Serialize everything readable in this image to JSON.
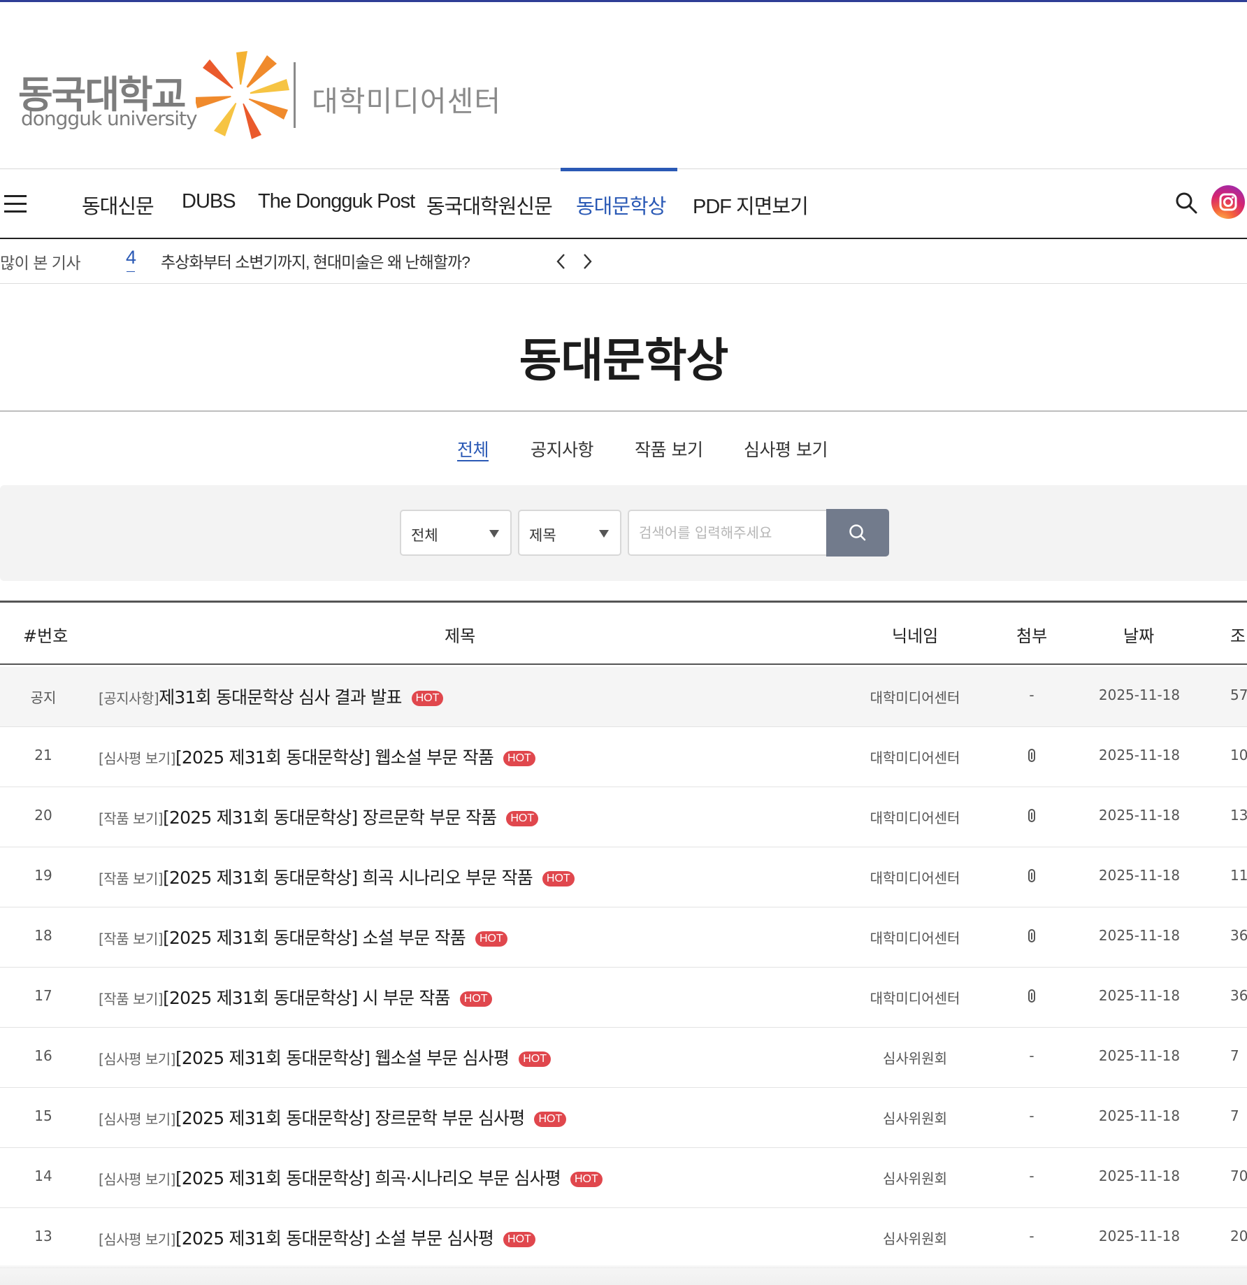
{
  "logo": {
    "korean": "동국대학교",
    "english": "dongguk university",
    "center_name": "대학미디어센터"
  },
  "nav": {
    "items": [
      {
        "label": "동대신문"
      },
      {
        "label": "DUBS"
      },
      {
        "label": "The Dongguk Post"
      },
      {
        "label": "동국대학원신문"
      },
      {
        "label": "동대문학상",
        "active": true
      },
      {
        "label": "PDF 지면보기"
      }
    ],
    "menu_icon": "hamburger-menu-icon",
    "search_icon": "search-icon",
    "instagram_icon": "instagram-icon",
    "accent_color": "#2a59b5"
  },
  "ticker": {
    "label": "많이 본 기사",
    "rank": "4",
    "headline": "추상화부터 소변기까지, 현대미술은 왜 난해할까?"
  },
  "page": {
    "title": "동대문학상"
  },
  "categories": [
    {
      "label": "전체",
      "active": true
    },
    {
      "label": "공지사항"
    },
    {
      "label": "작품 보기"
    },
    {
      "label": "심사평 보기"
    }
  ],
  "search": {
    "category_value": "전체",
    "field_value": "제목",
    "placeholder": "검색어를 입력해주세요",
    "button_color": "#727b8c"
  },
  "table": {
    "headers": {
      "number": "#번호",
      "title": "제목",
      "nickname": "닉네임",
      "attachment": "첨부",
      "date": "날짜",
      "views": "조"
    },
    "hot_label": "HOT",
    "hot_color": "#e0474d",
    "rows": [
      {
        "num": "공지",
        "category": "[공지사항]",
        "title": "제31회 동대문학상 심사 결과 발표",
        "nickname": "대학미디어센터",
        "attach": "-",
        "date": "2025-11-18",
        "views": "57",
        "notice": true
      },
      {
        "num": "21",
        "category": "[심사평 보기]",
        "title": "[2025 제31회 동대문학상] 웹소설 부문 작품",
        "nickname": "대학미디어센터",
        "attach": "clip",
        "date": "2025-11-18",
        "views": "10"
      },
      {
        "num": "20",
        "category": "[작품 보기]",
        "title": "[2025 제31회 동대문학상] 장르문학 부문 작품",
        "nickname": "대학미디어센터",
        "attach": "clip",
        "date": "2025-11-18",
        "views": "13"
      },
      {
        "num": "19",
        "category": "[작품 보기]",
        "title": "[2025 제31회 동대문학상] 희곡 시나리오 부문 작품",
        "nickname": "대학미디어센터",
        "attach": "clip",
        "date": "2025-11-18",
        "views": "11"
      },
      {
        "num": "18",
        "category": "[작품 보기]",
        "title": "[2025 제31회 동대문학상] 소설 부문 작품",
        "nickname": "대학미디어센터",
        "attach": "clip",
        "date": "2025-11-18",
        "views": "36"
      },
      {
        "num": "17",
        "category": "[작품 보기]",
        "title": "[2025 제31회 동대문학상] 시 부문 작품",
        "nickname": "대학미디어센터",
        "attach": "clip",
        "date": "2025-11-18",
        "views": "36"
      },
      {
        "num": "16",
        "category": "[심사평 보기]",
        "title": "[2025 제31회 동대문학상] 웹소설 부문 심사평",
        "nickname": "심사위원회",
        "attach": "-",
        "date": "2025-11-18",
        "views": "7"
      },
      {
        "num": "15",
        "category": "[심사평 보기]",
        "title": "[2025 제31회 동대문학상] 장르문학 부문 심사평",
        "nickname": "심사위원회",
        "attach": "-",
        "date": "2025-11-18",
        "views": "7"
      },
      {
        "num": "14",
        "category": "[심사평 보기]",
        "title": "[2025 제31회 동대문학상] 희곡·시나리오 부문 심사평",
        "nickname": "심사위원회",
        "attach": "-",
        "date": "2025-11-18",
        "views": "70"
      },
      {
        "num": "13",
        "category": "[심사평 보기]",
        "title": "[2025 제31회 동대문학상] 소설 부문 심사평",
        "nickname": "심사위원회",
        "attach": "-",
        "date": "2025-11-18",
        "views": "20"
      }
    ]
  }
}
